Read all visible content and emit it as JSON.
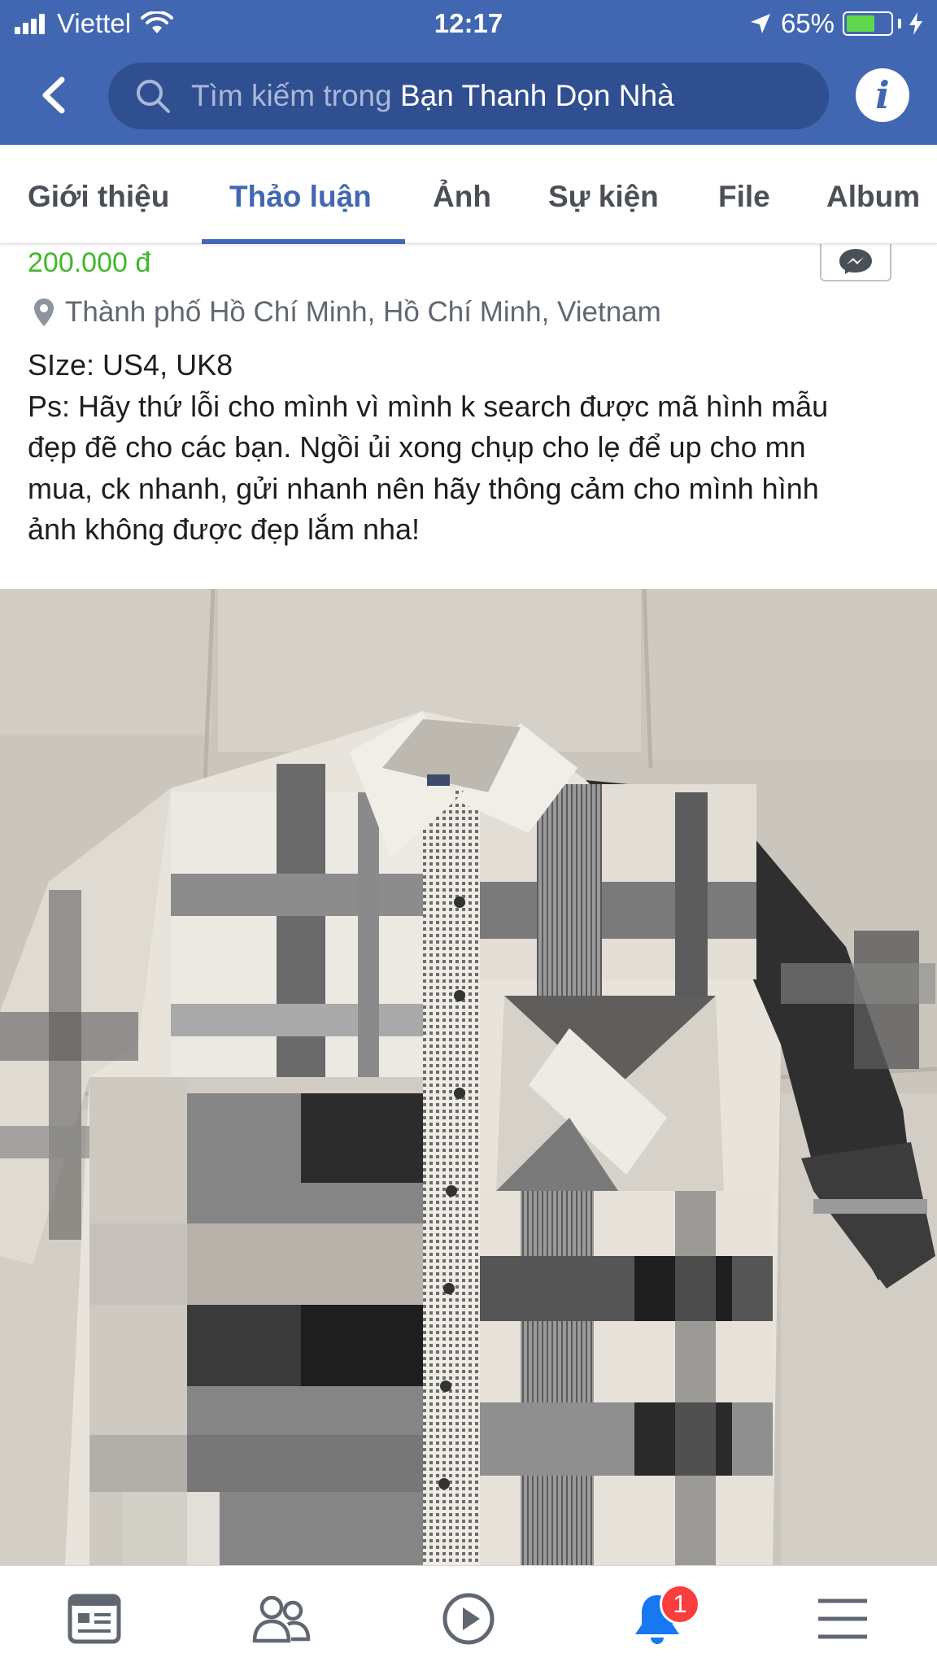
{
  "status_bar": {
    "carrier": "Viettel",
    "time": "12:17",
    "battery_percent": "65%",
    "battery_level": 0.65,
    "signal_bars": 4,
    "icons": [
      "signal-icon",
      "wifi-icon",
      "location-arrow-icon",
      "battery-icon",
      "charging-bolt-icon"
    ]
  },
  "header": {
    "back_icon": "chevron-left-icon",
    "search_placeholder": "Tìm kiếm trong",
    "search_group_name": "Bạn Thanh Dọn Nhà",
    "info_label": "i",
    "colors": {
      "bar": "#4267b2",
      "search_bg": "#2f4f91"
    }
  },
  "tabs": {
    "items": [
      {
        "label": "Giới thiệu",
        "active": false
      },
      {
        "label": "Thảo luận",
        "active": true
      },
      {
        "label": "Ảnh",
        "active": false
      },
      {
        "label": "Sự kiện",
        "active": false
      },
      {
        "label": "File",
        "active": false
      },
      {
        "label": "Album",
        "active": false
      }
    ],
    "accent_color": "#4267b2"
  },
  "post": {
    "price": "200.000 đ",
    "price_color": "#42b72a",
    "location": "Thành phố Hồ Chí Minh, Hồ Chí Minh, Vietnam",
    "description_lines": [
      "SIze: US4, UK8",
      "Ps: Hãy thứ lỗi cho mình vì mình k search được mã hình mẫu",
      "đẹp đẽ cho các bạn. Ngồi ủi xong chụp cho lẹ để up cho mn",
      "mua, ck nhanh, gửi nhanh nên hãy thông cảm cho mình hình",
      "ảnh không được đẹp lắm nha!"
    ],
    "messenger_icon": "messenger-icon",
    "photo_subject": "plaid-shirt-photo"
  },
  "bottom_nav": {
    "items": [
      {
        "icon": "news-feed-icon"
      },
      {
        "icon": "groups-icon"
      },
      {
        "icon": "watch-play-icon"
      },
      {
        "icon": "notifications-bell-icon",
        "badge": "1"
      },
      {
        "icon": "menu-icon"
      }
    ]
  }
}
